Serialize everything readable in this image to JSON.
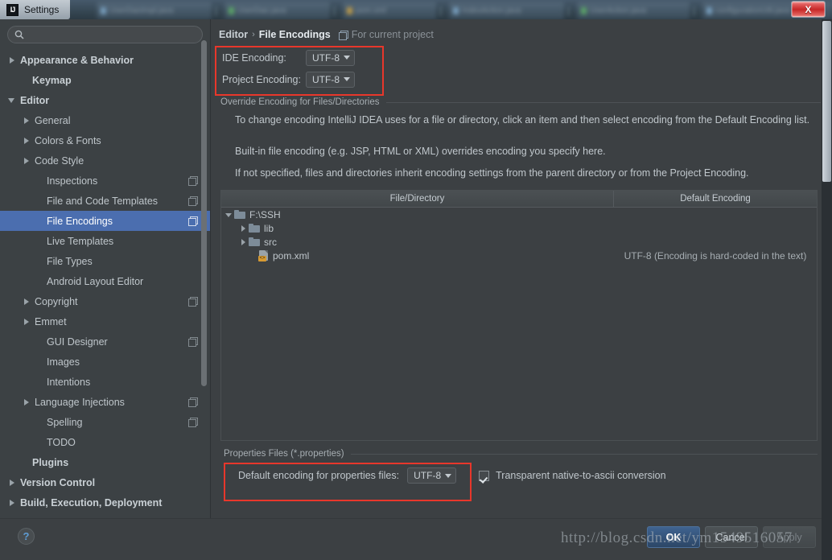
{
  "window": {
    "title": "Settings",
    "logo_text": "IJ",
    "close_label": "X",
    "backdrop_tabs": [
      {
        "label": "UserDaoImpl.java"
      },
      {
        "label": "UserDao.java"
      },
      {
        "label": "pom.xml"
      },
      {
        "label": "IndexAction.java"
      },
      {
        "label": "UserAction.java"
      },
      {
        "label": "configurationUtil.java"
      }
    ]
  },
  "search": {
    "value": "",
    "placeholder": "",
    "icon": "search-icon"
  },
  "sidebar": {
    "items": [
      {
        "label": "Appearance & Behavior",
        "arrow": "right",
        "bold": true,
        "indent": 10,
        "overlay": false,
        "selected": false
      },
      {
        "label": "Keymap",
        "arrow": "none",
        "bold": true,
        "indent": 25,
        "overlay": false,
        "selected": false
      },
      {
        "label": "Editor",
        "arrow": "down",
        "bold": true,
        "indent": 10,
        "overlay": false,
        "selected": false
      },
      {
        "label": "General",
        "arrow": "right",
        "bold": false,
        "indent": 28,
        "overlay": false,
        "selected": false
      },
      {
        "label": "Colors & Fonts",
        "arrow": "right",
        "bold": false,
        "indent": 28,
        "overlay": false,
        "selected": false
      },
      {
        "label": "Code Style",
        "arrow": "right",
        "bold": false,
        "indent": 28,
        "overlay": false,
        "selected": false
      },
      {
        "label": "Inspections",
        "arrow": "none",
        "bold": false,
        "indent": 43,
        "overlay": true,
        "selected": false
      },
      {
        "label": "File and Code Templates",
        "arrow": "none",
        "bold": false,
        "indent": 43,
        "overlay": true,
        "selected": false
      },
      {
        "label": "File Encodings",
        "arrow": "none",
        "bold": false,
        "indent": 43,
        "overlay": true,
        "selected": true
      },
      {
        "label": "Live Templates",
        "arrow": "none",
        "bold": false,
        "indent": 43,
        "overlay": false,
        "selected": false
      },
      {
        "label": "File Types",
        "arrow": "none",
        "bold": false,
        "indent": 43,
        "overlay": false,
        "selected": false
      },
      {
        "label": "Android Layout Editor",
        "arrow": "none",
        "bold": false,
        "indent": 43,
        "overlay": false,
        "selected": false
      },
      {
        "label": "Copyright",
        "arrow": "right",
        "bold": false,
        "indent": 28,
        "overlay": true,
        "selected": false
      },
      {
        "label": "Emmet",
        "arrow": "right",
        "bold": false,
        "indent": 28,
        "overlay": false,
        "selected": false
      },
      {
        "label": "GUI Designer",
        "arrow": "none",
        "bold": false,
        "indent": 43,
        "overlay": true,
        "selected": false
      },
      {
        "label": "Images",
        "arrow": "none",
        "bold": false,
        "indent": 43,
        "overlay": false,
        "selected": false
      },
      {
        "label": "Intentions",
        "arrow": "none",
        "bold": false,
        "indent": 43,
        "overlay": false,
        "selected": false
      },
      {
        "label": "Language Injections",
        "arrow": "right",
        "bold": false,
        "indent": 28,
        "overlay": true,
        "selected": false
      },
      {
        "label": "Spelling",
        "arrow": "none",
        "bold": false,
        "indent": 43,
        "overlay": true,
        "selected": false
      },
      {
        "label": "TODO",
        "arrow": "none",
        "bold": false,
        "indent": 43,
        "overlay": false,
        "selected": false
      },
      {
        "label": "Plugins",
        "arrow": "none",
        "bold": true,
        "indent": 25,
        "overlay": false,
        "selected": false
      },
      {
        "label": "Version Control",
        "arrow": "right",
        "bold": true,
        "indent": 10,
        "overlay": false,
        "selected": false
      },
      {
        "label": "Build, Execution, Deployment",
        "arrow": "right",
        "bold": true,
        "indent": 10,
        "overlay": false,
        "selected": false
      }
    ]
  },
  "breadcrumb": {
    "parent": "Editor",
    "separator": "›",
    "current": "File Encodings",
    "scope_label": "For current project",
    "scope_icon": "project-scope-icon"
  },
  "encodings": {
    "ide_label": "IDE Encoding:",
    "ide_value": "UTF-8",
    "project_label": "Project Encoding:",
    "project_value": "UTF-8"
  },
  "override_group": {
    "title": "Override Encoding for Files/Directories",
    "desc_1": "To change encoding IntelliJ IDEA uses for a file or directory, click an item and then select encoding from the Default Encoding list.",
    "desc_2": "Built-in file encoding (e.g. JSP, HTML or XML) overrides encoding you specify here.",
    "desc_3": "If not specified, files and directories inherit encoding settings from the parent directory or from the Project Encoding."
  },
  "table": {
    "columns": [
      "File/Directory",
      "Default Encoding"
    ],
    "rows": [
      {
        "name": "F:\\SSH",
        "arrow": "down",
        "icon": "folder-icon",
        "indent": 4,
        "encoding": ""
      },
      {
        "name": "lib",
        "arrow": "right",
        "icon": "folder-icon",
        "indent": 22,
        "encoding": ""
      },
      {
        "name": "src",
        "arrow": "right",
        "icon": "folder-icon",
        "indent": 22,
        "encoding": ""
      },
      {
        "name": "pom.xml",
        "arrow": "none",
        "icon": "xml-file-icon",
        "indent": 34,
        "encoding": "UTF-8 (Encoding is hard-coded in the text)"
      }
    ]
  },
  "properties_group": {
    "title": "Properties Files (*.properties)",
    "label": "Default encoding for properties files:",
    "value": "UTF-8",
    "checkbox_label": "Transparent native-to-ascii conversion",
    "checkbox_checked": true
  },
  "footer": {
    "help_label": "?",
    "ok_label": "OK",
    "cancel_label": "Cancel",
    "apply_label": "Apply"
  },
  "watermark": {
    "text": "http://blog.csdn.net/ym1549516057"
  },
  "colors": {
    "selection": "#4b6eaf",
    "annotation_red": "#e8372b",
    "panel_bg": "#3c4043",
    "primary_button": "#3f6390",
    "close_button": "#c62828"
  }
}
